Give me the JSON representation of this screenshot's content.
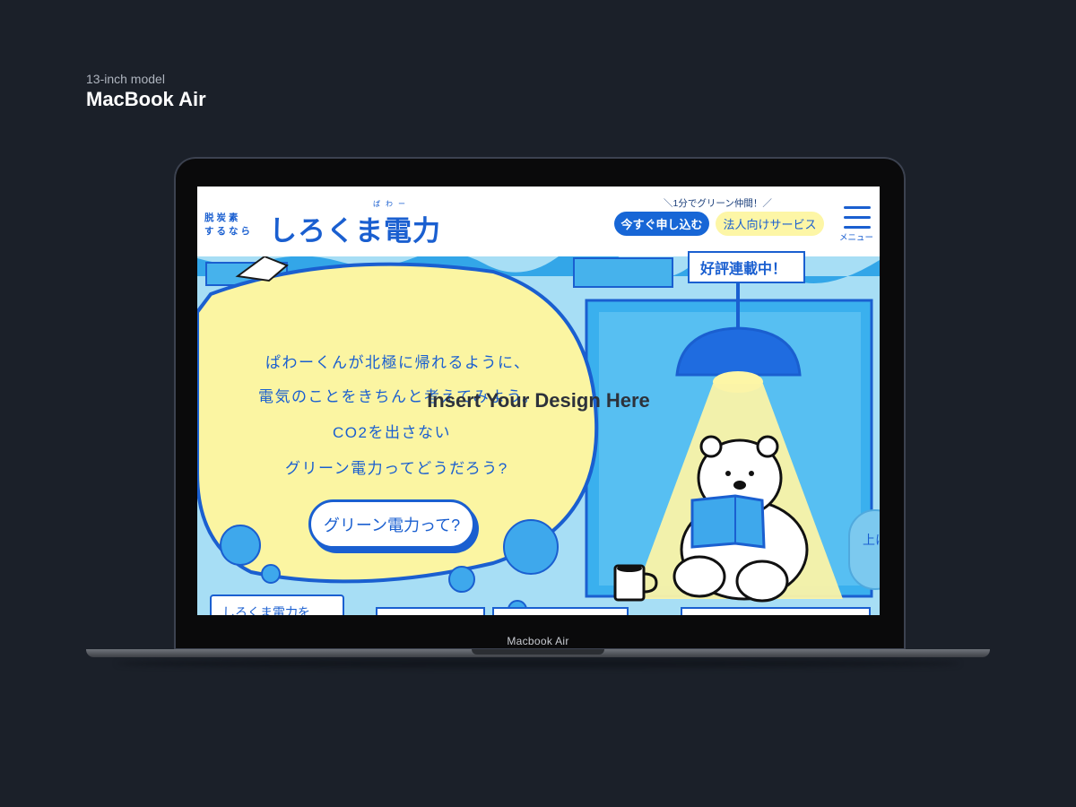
{
  "mockup": {
    "model_sub": "13-inch model",
    "model_title": "MacBook Air",
    "bezel_label": "Macbook Air",
    "placeholder": "Insert Your Design Here"
  },
  "site": {
    "logo_small_line1": "脱炭素",
    "logo_small_line2": "するなら",
    "logo_main": "しろくま電力",
    "logo_ruby": "ぱわー",
    "tagline": "＼1分でグリーン仲間！／",
    "apply_button": "今すぐ申し込む",
    "business_button": "法人向けサービス",
    "menu_label": "メニュー",
    "sign_text": "好評連載中！",
    "hero_lines": [
      "ぱわーくんが北極に帰れるように、",
      "電気のことをきちんと考えてみよう。",
      "CO2を出さない",
      "グリーン電力ってどうだろう?"
    ],
    "cta_button": "グリーン電力って?",
    "bottom_card": "しろくま電力を",
    "side_tab": "上に"
  },
  "colors": {
    "brand_blue": "#1a5fd0",
    "sky_blue": "#9fdaf3",
    "bubble_yellow": "#fbf5a2",
    "background": "#1b2029"
  }
}
